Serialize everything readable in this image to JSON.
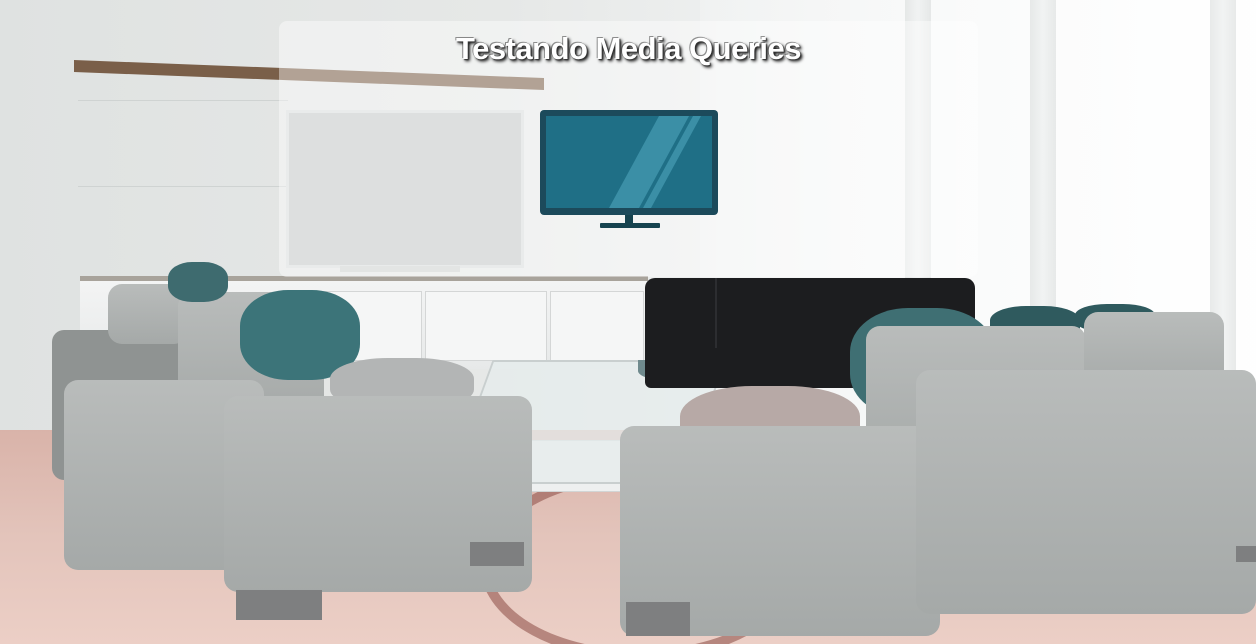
{
  "page": {
    "title": "Testando Media Queries"
  },
  "icon": {
    "name": "television-icon",
    "colors": {
      "frame": "#1c4a5b",
      "screen": "#1f6f86",
      "reflection": "#3b8fa6",
      "stand": "#16434f"
    }
  },
  "background": {
    "description_icon": "living-room-photo"
  }
}
